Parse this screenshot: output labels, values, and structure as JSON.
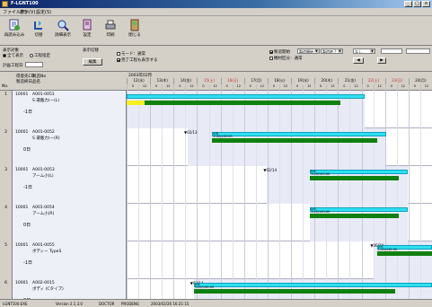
{
  "window": {
    "title": "F-LGNT100"
  },
  "menu": [
    "ファイル(F)",
    "表示(V)",
    "設定(S)"
  ],
  "toolbar": [
    {
      "label": "再読み込み",
      "icon": "reload-icon"
    },
    {
      "label": "切替",
      "icon": "switch-icon"
    },
    {
      "label": "詳細表示",
      "icon": "detail-icon"
    },
    {
      "label": "設定",
      "icon": "settings-icon"
    },
    {
      "label": "印刷",
      "icon": "print-icon"
    },
    {
      "label": "閉じる",
      "icon": "close-doc-icon"
    }
  ],
  "options": {
    "group_label": "表示対象",
    "radio_all": "全て表示",
    "radio_process": "工程指定",
    "filter_label": "計画工程日",
    "display_label": "表示切替",
    "check1": "モード：通常",
    "check2": "完了工程も表示する",
    "edit_button": "編集",
    "right_check1": "製造開始",
    "right_check2": "機材区分：通常",
    "combo1": "製造開始",
    "combo2": "製造終了",
    "combo3": "なし"
  },
  "header": {
    "col_no": "No.",
    "col_code": "得意先CD",
    "col_code2": "製造終日",
    "col_ident": "製造No",
    "col_name": "品名",
    "month": "2003年02月",
    "days": [
      "12(水)",
      "13(木)",
      "14(金)",
      "15(土)",
      "16(日)",
      "17(月)",
      "18(火)",
      "19(水)",
      "20(木)",
      "21(金)",
      "22(土)",
      "23(日)",
      "24(月)"
    ],
    "holidays": [
      3,
      4,
      10,
      11
    ],
    "hours": [
      "0",
      "12"
    ]
  },
  "rows": [
    {
      "no": "1",
      "code": "10001",
      "ident": "A001-0051",
      "name": "S 運搬力(ー(L)",
      "delta": "-1日",
      "markers": [],
      "bars": [
        {
          "color": "navy",
          "start": 0.0,
          "end": 0.5,
          "line": 0,
          "label": ""
        },
        {
          "color": "cyan",
          "start": 0.0,
          "end": 0.78,
          "line": 0,
          "label": ""
        },
        {
          "color": "yellow",
          "start": 0.0,
          "end": 0.06,
          "line": 1,
          "label": ""
        },
        {
          "color": "green",
          "start": 0.06,
          "end": 0.7,
          "line": 1,
          "label": ""
        }
      ],
      "shade": [
        0.0,
        0.78
      ]
    },
    {
      "no": "2",
      "code": "10001",
      "ident": "A001-0052",
      "name": "S 運搬力(ー(R)",
      "delta": "0日",
      "markers": [
        {
          "pos": 0.2,
          "text": "▼02/13"
        }
      ],
      "bars": [
        {
          "color": "cyan",
          "start": 0.28,
          "end": 0.85,
          "line": 0,
          "label": "0/6"
        },
        {
          "color": "green",
          "start": 0.28,
          "end": 0.82,
          "line": 1,
          "label": "1:00/140:00"
        }
      ],
      "shade": [
        0.2,
        0.85
      ]
    },
    {
      "no": "3",
      "code": "10001",
      "ident": "A001-0053",
      "name": "アーム小(L)",
      "delta": "-1日",
      "markers": [
        {
          "pos": 0.46,
          "text": "▼02/14"
        }
      ],
      "bars": [
        {
          "color": "cyan",
          "start": 0.6,
          "end": 0.92,
          "line": 0,
          "label": "0/6"
        },
        {
          "color": "green",
          "start": 0.6,
          "end": 0.89,
          "line": 1,
          "label": "1:00/140:00"
        }
      ],
      "shade": [
        0.46,
        0.92
      ]
    },
    {
      "no": "4",
      "code": "10001",
      "ident": "A001-0054",
      "name": "アーム小(R)",
      "delta": "0日",
      "markers": [],
      "bars": [
        {
          "color": "cyan",
          "start": 0.6,
          "end": 0.92,
          "line": 0,
          "label": "0/6"
        },
        {
          "color": "green",
          "start": 0.6,
          "end": 0.89,
          "line": 1,
          "label": "1:00/140:00"
        }
      ],
      "shade": [
        0.6,
        0.92
      ]
    },
    {
      "no": "5",
      "code": "10001",
      "ident": "A001-0055",
      "name": "ボディー TypeS",
      "delta": "-1日",
      "markers": [
        {
          "pos": 0.81,
          "text": "▼06/20"
        }
      ],
      "bars": [
        {
          "color": "cyan",
          "start": 0.82,
          "end": 1.0,
          "line": 0,
          "label": "0/6"
        },
        {
          "color": "green",
          "start": 0.82,
          "end": 1.0,
          "line": 1,
          "label": "1:00/140:00"
        }
      ],
      "shade": [
        0.81,
        1.0
      ]
    },
    {
      "no": "6",
      "code": "10001",
      "ident": "A002-0015",
      "name": "ボディ (Cタイプ)",
      "delta": "0日",
      "markers": [
        {
          "pos": 0.22,
          "text": "▼02/14"
        }
      ],
      "bars": [
        {
          "color": "cyan",
          "start": 0.22,
          "end": 1.0,
          "line": 0,
          "label": "0/6"
        },
        {
          "color": "green",
          "start": 0.22,
          "end": 0.88,
          "line": 1,
          "label": "1:00/140:00"
        }
      ],
      "shade": [
        0.22,
        1.0
      ]
    }
  ],
  "status": {
    "left": "LGNT100.EXE",
    "version": "Version 2.1.3.0",
    "user": "DOCTOR",
    "pc": "PRODENG",
    "date": "2003/02/26 16:21:15"
  }
}
